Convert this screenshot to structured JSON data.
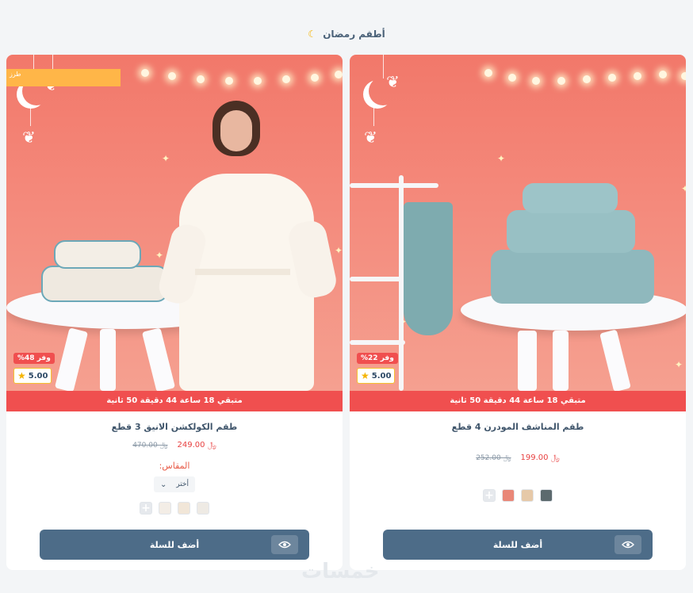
{
  "section": {
    "title": "أطقم رمضان",
    "moon_icon": "crescent-moon-icon"
  },
  "products": [
    {
      "name": "طقم المناشف المودرن 4 قطع",
      "countdown": "متبقي 18 ساعة 44 دقيقة 50 ثانية",
      "discount": "وفر 22%",
      "rating": "5.00",
      "price_new": "199.00 ﷼",
      "price_old": "252.00 ﷼",
      "cart_label": "أضف للسلة",
      "swatch_colors": [
        "#5c6a6e",
        "#e6c9a8",
        "#e98778"
      ]
    },
    {
      "name": "طقم الكولكشن الانيق 3 قطع",
      "countdown": "متبقي 18 ساعة 44 دقيقة 50 ثانية",
      "discount": "وفر 48%",
      "rating": "5.00",
      "tag": "طرز",
      "price_new": "249.00 ﷼",
      "price_old": "470.00 ﷼",
      "size_label": "المقاس:",
      "size_value": "أختر",
      "cart_label": "أضف للسلة",
      "swatch_colors": [
        "#eeeae4",
        "#f1e6d8",
        "#f3ede6"
      ]
    }
  ],
  "watermark": "خمسات",
  "colors": {
    "accent": "#4d6c88",
    "sale": "#f04f4f",
    "star": "#f5b400"
  }
}
